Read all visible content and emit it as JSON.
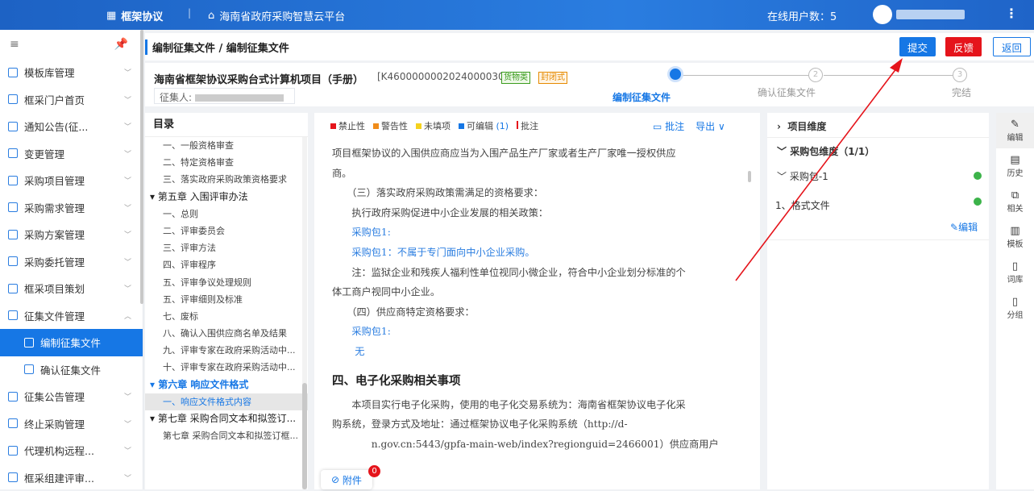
{
  "topbar": {
    "brand": "框架协议",
    "separator": "|",
    "platform": "海南省政府采购智慧云平台",
    "online": "在线用户数：5",
    "more": "⋮"
  },
  "sidebar": {
    "items": [
      {
        "label": "模板库管理",
        "arrow": "﹀"
      },
      {
        "label": "框采门户首页",
        "arrow": "﹀"
      },
      {
        "label": "通知公告(征...",
        "arrow": "﹀"
      },
      {
        "label": "变更管理",
        "arrow": "﹀"
      },
      {
        "label": "采购项目管理",
        "arrow": "﹀"
      },
      {
        "label": "采购需求管理",
        "arrow": "﹀"
      },
      {
        "label": "采购方案管理",
        "arrow": "﹀"
      },
      {
        "label": "采购委托管理",
        "arrow": "﹀"
      },
      {
        "label": "框采项目策划",
        "arrow": "﹀"
      },
      {
        "label": "征集文件管理",
        "arrow": "︿"
      },
      {
        "label": "编制征集文件",
        "active": true
      },
      {
        "label": "确认征集文件"
      },
      {
        "label": "征集公告管理",
        "arrow": "﹀"
      },
      {
        "label": "终止采购管理",
        "arrow": "﹀"
      },
      {
        "label": "代理机构远程...",
        "arrow": "﹀"
      },
      {
        "label": "框采组建评审...",
        "arrow": "﹀"
      }
    ]
  },
  "header": {
    "breadcrumb": "编制征集文件 / 编制征集文件",
    "submit": "提交",
    "feedback": "反馈",
    "back": "返回"
  },
  "project": {
    "title": "海南省框架协议采购台式计算机项目（手册）",
    "code": "[K4600000002024000030]",
    "tag1": "货物类",
    "tag2": "封闭式",
    "collector_label": "征集人:"
  },
  "steps": [
    {
      "label": "编制征集文件",
      "num": "1"
    },
    {
      "label": "确认征集文件",
      "num": "2"
    },
    {
      "label": "完结",
      "num": "3"
    }
  ],
  "toc": {
    "title": "目录",
    "items": [
      {
        "t": "一、一般资格审查"
      },
      {
        "t": "二、特定资格审查"
      },
      {
        "t": "三、落实政府采购政策资格要求"
      },
      {
        "t": "▾ 第五章 入围评审办法",
        "ch": true
      },
      {
        "t": "一、总则"
      },
      {
        "t": "二、评审委员会"
      },
      {
        "t": "三、评审方法"
      },
      {
        "t": "四、评审程序"
      },
      {
        "t": "五、评审争议处理规则"
      },
      {
        "t": "五、评审细则及标准"
      },
      {
        "t": "七、废标"
      },
      {
        "t": "八、确认入围供应商名单及结果"
      },
      {
        "t": "九、评审专家在政府采购活动中..."
      },
      {
        "t": "十、评审专家在政府采购活动中..."
      },
      {
        "t": "▾ 第六章 响应文件格式",
        "ch": true,
        "blue": true
      },
      {
        "t": "一、响应文件格式内容",
        "sel": true
      },
      {
        "t": "▾ 第七章 采购合同文本和拟签订...",
        "ch": true
      },
      {
        "t": "第七章 采购合同文本和拟签订框..."
      }
    ]
  },
  "legend": [
    {
      "t": "禁止性",
      "c": "#e5141b"
    },
    {
      "t": "警告性",
      "c": "#f08c1a"
    },
    {
      "t": "未填项",
      "c": "#f5d21e"
    },
    {
      "t": "可编辑",
      "c": "#1677e5",
      "n": "(1)"
    },
    {
      "t": "批注",
      "c": "#e5141b",
      "bar": true
    }
  ],
  "doc_tools": {
    "annotate": "批注",
    "export": "导出 ∨"
  },
  "doc": [
    {
      "t": "项目框架协议的入围供应商应当为入围产品生产厂家或者生产厂家唯一授权供应"
    },
    {
      "t": "商。"
    },
    {
      "t": "　　（三）落实政府采购政策需满足的资格要求："
    },
    {
      "t": "　　执行政府采购促进中小企业发展的相关政策："
    },
    {
      "t": "　　采购包1:",
      "b": true
    },
    {
      "t": "　　采购包1：不属于专门面向中小企业采购。",
      "b": true
    },
    {
      "t": "　　注：监狱企业和残疾人福利性单位视同小微企业，符合中小企业划分标准的个"
    },
    {
      "t": "体工商户视同中小企业。"
    },
    {
      "t": "　　（四）供应商特定资格要求："
    },
    {
      "t": "　　采购包1:",
      "b": true
    },
    {
      "t": "　　 无",
      "b": true
    },
    {
      "t": "四、电子化采购相关事项",
      "h": true
    },
    {
      "t": "　　本项目实行电子化采购，使用的电子化交易系统为：海南省框架协议电子化采"
    },
    {
      "t": "购系统，登录方式及地址：通过框架协议电子化采购系统（http://d-"
    },
    {
      "t": "　　　　n.gov.cn:5443/gpfa-main-web/index?regionguid=2466001）供应商用户"
    }
  ],
  "attach": {
    "label": "附件",
    "count": "0"
  },
  "right": {
    "proj_dim": "项目维度",
    "pkg_dim": "采购包维度（1/1）",
    "pkg1": "采购包-1",
    "format": "1、格式文件",
    "edit": "编辑"
  },
  "rail": [
    {
      "g": "✎",
      "t": "编辑"
    },
    {
      "g": "▤",
      "t": "历史"
    },
    {
      "g": "⧉",
      "t": "相关"
    },
    {
      "g": "▥",
      "t": "模板"
    },
    {
      "g": "▯",
      "t": "词库"
    },
    {
      "g": "▯",
      "t": "分组"
    }
  ]
}
